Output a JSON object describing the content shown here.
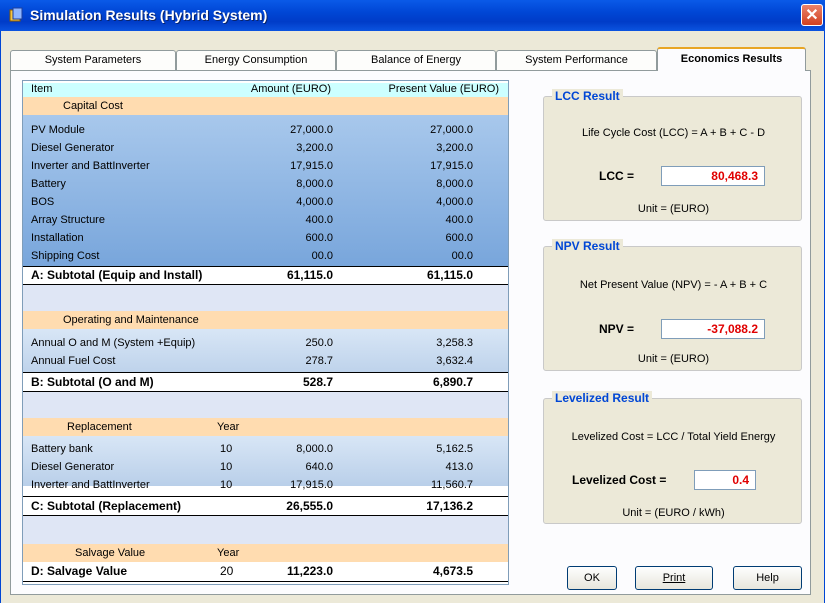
{
  "window": {
    "title": "Simulation Results (Hybrid System)",
    "close_glyph": "✕",
    "icon": "app-icon"
  },
  "tabs": [
    {
      "label": "System Parameters",
      "active": false
    },
    {
      "label": "Energy Consumption",
      "active": false
    },
    {
      "label": "Balance of Energy",
      "active": false
    },
    {
      "label": "System Performance",
      "active": false
    },
    {
      "label": "Economics Results",
      "active": true
    }
  ],
  "table": {
    "headers": {
      "item": "Item",
      "amount": "Amount (EURO)",
      "present_value": "Present Value (EURO)"
    },
    "capital": {
      "title": "Capital Cost",
      "rows": [
        {
          "item": "PV Module",
          "amount": "27,000.0",
          "pv": "27,000.0"
        },
        {
          "item": "Diesel Generator",
          "amount": "3,200.0",
          "pv": "3,200.0"
        },
        {
          "item": "Inverter and BattInverter",
          "amount": "17,915.0",
          "pv": "17,915.0"
        },
        {
          "item": "Battery",
          "amount": "8,000.0",
          "pv": "8,000.0"
        },
        {
          "item": "BOS",
          "amount": "4,000.0",
          "pv": "4,000.0"
        },
        {
          "item": "Array Structure",
          "amount": "400.0",
          "pv": "400.0"
        },
        {
          "item": "Installation",
          "amount": "600.0",
          "pv": "600.0"
        },
        {
          "item": "Shipping Cost",
          "amount": "00.0",
          "pv": "00.0"
        }
      ],
      "subtotal": {
        "item": "A: Subtotal (Equip and Install)",
        "amount": "61,115.0",
        "pv": "61,115.0"
      }
    },
    "om": {
      "title": "Operating and Maintenance",
      "rows": [
        {
          "item": "Annual O and M (System +Equip)",
          "amount": "250.0",
          "pv": "3,258.3"
        },
        {
          "item": "Annual Fuel Cost",
          "amount": "278.7",
          "pv": "3,632.4"
        }
      ],
      "subtotal": {
        "item": "B: Subtotal (O and M)",
        "amount": "528.7",
        "pv": "6,890.7"
      }
    },
    "replacement": {
      "title": "Replacement",
      "year_label": "Year",
      "rows": [
        {
          "item": "Battery bank",
          "year": "10",
          "amount": "8,000.0",
          "pv": "5,162.5"
        },
        {
          "item": "Diesel Generator",
          "year": "10",
          "amount": "640.0",
          "pv": "413.0"
        },
        {
          "item": "Inverter and BattInverter",
          "year": "10",
          "amount": "17,915.0",
          "pv": "11,560.7"
        }
      ],
      "subtotal": {
        "item": "C: Subtotal (Replacement)",
        "amount": "26,555.0",
        "pv": "17,136.2"
      }
    },
    "salvage": {
      "title": "Salvage Value",
      "year_label": "Year",
      "row": {
        "item": "D: Salvage Value",
        "year": "20",
        "amount": "11,223.0",
        "pv": "4,673.5"
      }
    }
  },
  "lcc": {
    "legend": "LCC Result",
    "formula": "Life Cycle Cost (LCC)  =  A + B + C - D",
    "label": "LCC  =",
    "value": "80,468.3",
    "unit": "Unit =   (EURO)"
  },
  "npv": {
    "legend": "NPV Result",
    "formula": "Net Present Value (NPV) = - A + B + C",
    "label": "NPV  =",
    "value": "-37,088.2",
    "unit": "Unit =   (EURO)"
  },
  "levelized": {
    "legend": "Levelized Result",
    "formula": "Levelized Cost = LCC / Total Yield Energy",
    "label": "Levelized Cost  =",
    "value": "0.4",
    "unit": "Unit =   (EURO / kWh)"
  },
  "buttons": {
    "ok": "OK",
    "print": "Print",
    "help": "Help"
  },
  "colors": {
    "title_bar": "#0046d5",
    "legend": "#0046d5",
    "value_text": "#e00000",
    "section_header": "#ffdcb0",
    "table_header": "#ccffff"
  }
}
